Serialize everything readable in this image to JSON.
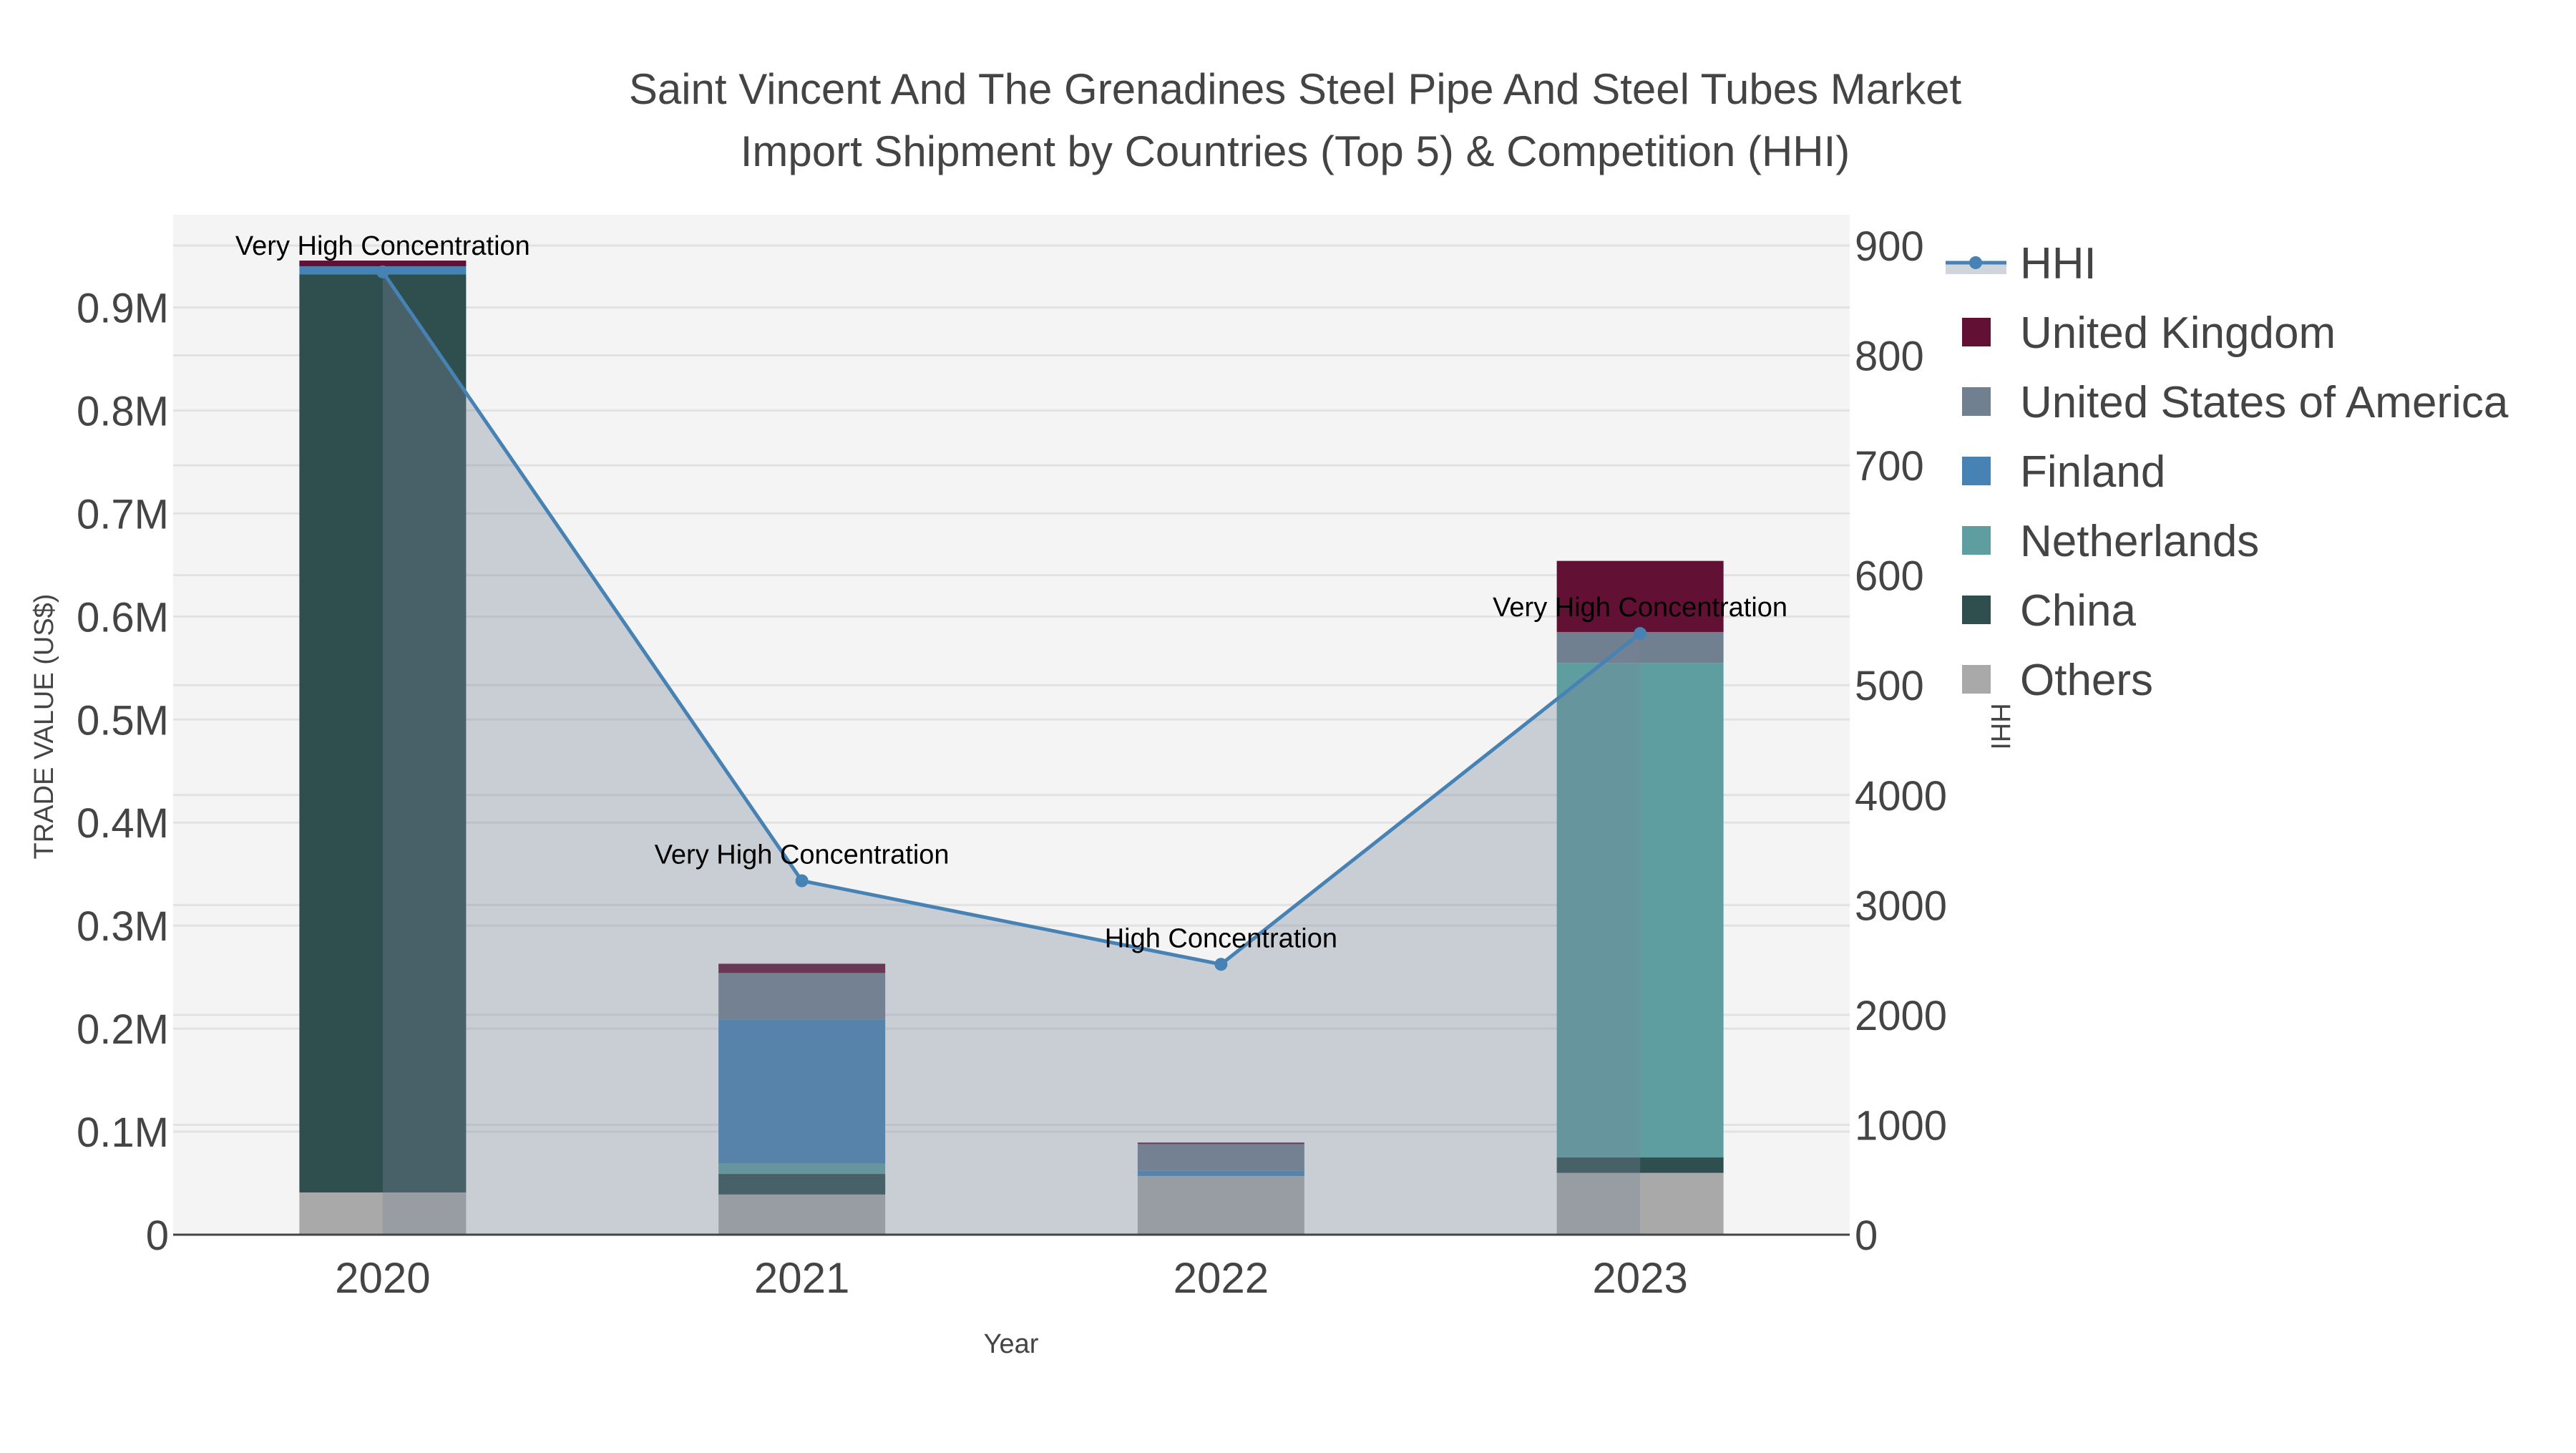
{
  "chart_data": {
    "type": "bar",
    "title_line1": "Saint Vincent And The Grenadines Steel Pipe And Steel Tubes Market",
    "title_line2": "Import Shipment by Countries (Top 5) & Competition (HHI)",
    "xlabel": "Year",
    "ylabel": "TRADE VALUE (US$)",
    "y2label": "HHI",
    "categories": [
      "2020",
      "2021",
      "2022",
      "2023"
    ],
    "ylim": [
      0,
      0.99
    ],
    "y_unit": "million US$",
    "y_ticks": [
      {
        "value": 0,
        "label": "0"
      },
      {
        "value": 0.1,
        "label": "0.1M"
      },
      {
        "value": 0.2,
        "label": "0.2M"
      },
      {
        "value": 0.3,
        "label": "0.3M"
      },
      {
        "value": 0.4,
        "label": "0.4M"
      },
      {
        "value": 0.5,
        "label": "0.5M"
      },
      {
        "value": 0.6,
        "label": "0.6M"
      },
      {
        "value": 0.7,
        "label": "0.7M"
      },
      {
        "value": 0.8,
        "label": "0.8M"
      },
      {
        "value": 0.9,
        "label": "0.9M"
      }
    ],
    "y2lim": [
      0,
      9280
    ],
    "y2_ticks": [
      {
        "value": 0,
        "label": "0"
      },
      {
        "value": 1000,
        "label": "1000"
      },
      {
        "value": 2000,
        "label": "2000"
      },
      {
        "value": 3000,
        "label": "3000"
      },
      {
        "value": 4000,
        "label": "4000"
      },
      {
        "value": 5000,
        "label": "500"
      },
      {
        "value": 6000,
        "label": "600"
      },
      {
        "value": 7000,
        "label": "700"
      },
      {
        "value": 8000,
        "label": "800"
      },
      {
        "value": 9000,
        "label": "900"
      }
    ],
    "series": [
      {
        "name": "Others",
        "color": "#a9a9a9",
        "values": [
          0.041,
          0.039,
          0.057,
          0.06
        ]
      },
      {
        "name": "China",
        "color": "#2f4f4f",
        "values": [
          0.891,
          0.02,
          0,
          0.015
        ]
      },
      {
        "name": "Netherlands",
        "color": "#5f9ea0",
        "values": [
          0,
          0.01,
          0,
          0.48
        ]
      },
      {
        "name": "Finland",
        "color": "#4682b4",
        "values": [
          0.008,
          0.14,
          0.005,
          0
        ]
      },
      {
        "name": "United States of America",
        "color": "#708090",
        "values": [
          0,
          0.045,
          0.026,
          0.03
        ]
      },
      {
        "name": "United Kingdom",
        "color": "#621034",
        "values": [
          0.0055,
          0.009,
          0.0014,
          0.069
        ]
      }
    ],
    "hhi": {
      "name": "HHI",
      "color": "#4682b4",
      "values": [
        8760,
        3220,
        2460,
        5470
      ],
      "annotations": [
        "Very High Concentration",
        "Very High Concentration",
        "High Concentration",
        "Very High Concentration"
      ]
    },
    "legend": {
      "placement": "right",
      "entries": [
        "HHI",
        "United Kingdom",
        "United States of America",
        "Finland",
        "Netherlands",
        "China",
        "Others"
      ]
    },
    "grid": true
  }
}
